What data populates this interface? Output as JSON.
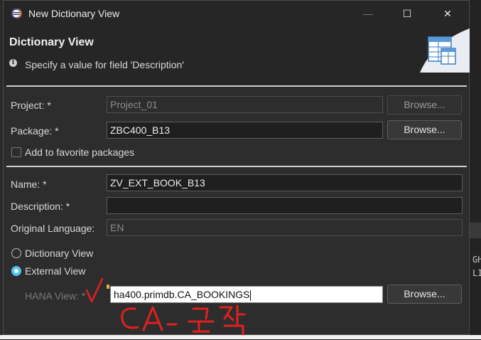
{
  "window": {
    "title": "New Dictionary View",
    "controls": {
      "minimize": "—",
      "maximize": "☐",
      "close": "✕"
    }
  },
  "header": {
    "title": "Dictionary View",
    "message": "Specify a value for field 'Description'",
    "info_icon": "i"
  },
  "form": {
    "project": {
      "label": "Project: *",
      "value": "Project_01",
      "browse": "Browse..."
    },
    "package": {
      "label": "Package: *",
      "value": "ZBC400_B13",
      "browse": "Browse..."
    },
    "favorite": {
      "label": "Add to favorite packages",
      "checked": false
    },
    "name": {
      "label": "Name: *",
      "value": "ZV_EXT_BOOK_B13"
    },
    "description": {
      "label": "Description: *",
      "value": ""
    },
    "language": {
      "label": "Original Language:",
      "value": "EN"
    },
    "view_type": {
      "options": [
        "Dictionary View",
        "External View"
      ],
      "selected": "External View"
    },
    "hana_view": {
      "label": "HANA View: *",
      "value": "ha400.primdb.CA_BOOKINGS",
      "browse": "Browse..."
    }
  },
  "background": {
    "right_text": [
      "GH",
      "LI"
    ]
  },
  "annotation": {
    "text": "CA- 조건",
    "color": "#e02020"
  },
  "colors": {
    "accent": "#4fc3f7",
    "required_marker": "#e8b04a"
  }
}
